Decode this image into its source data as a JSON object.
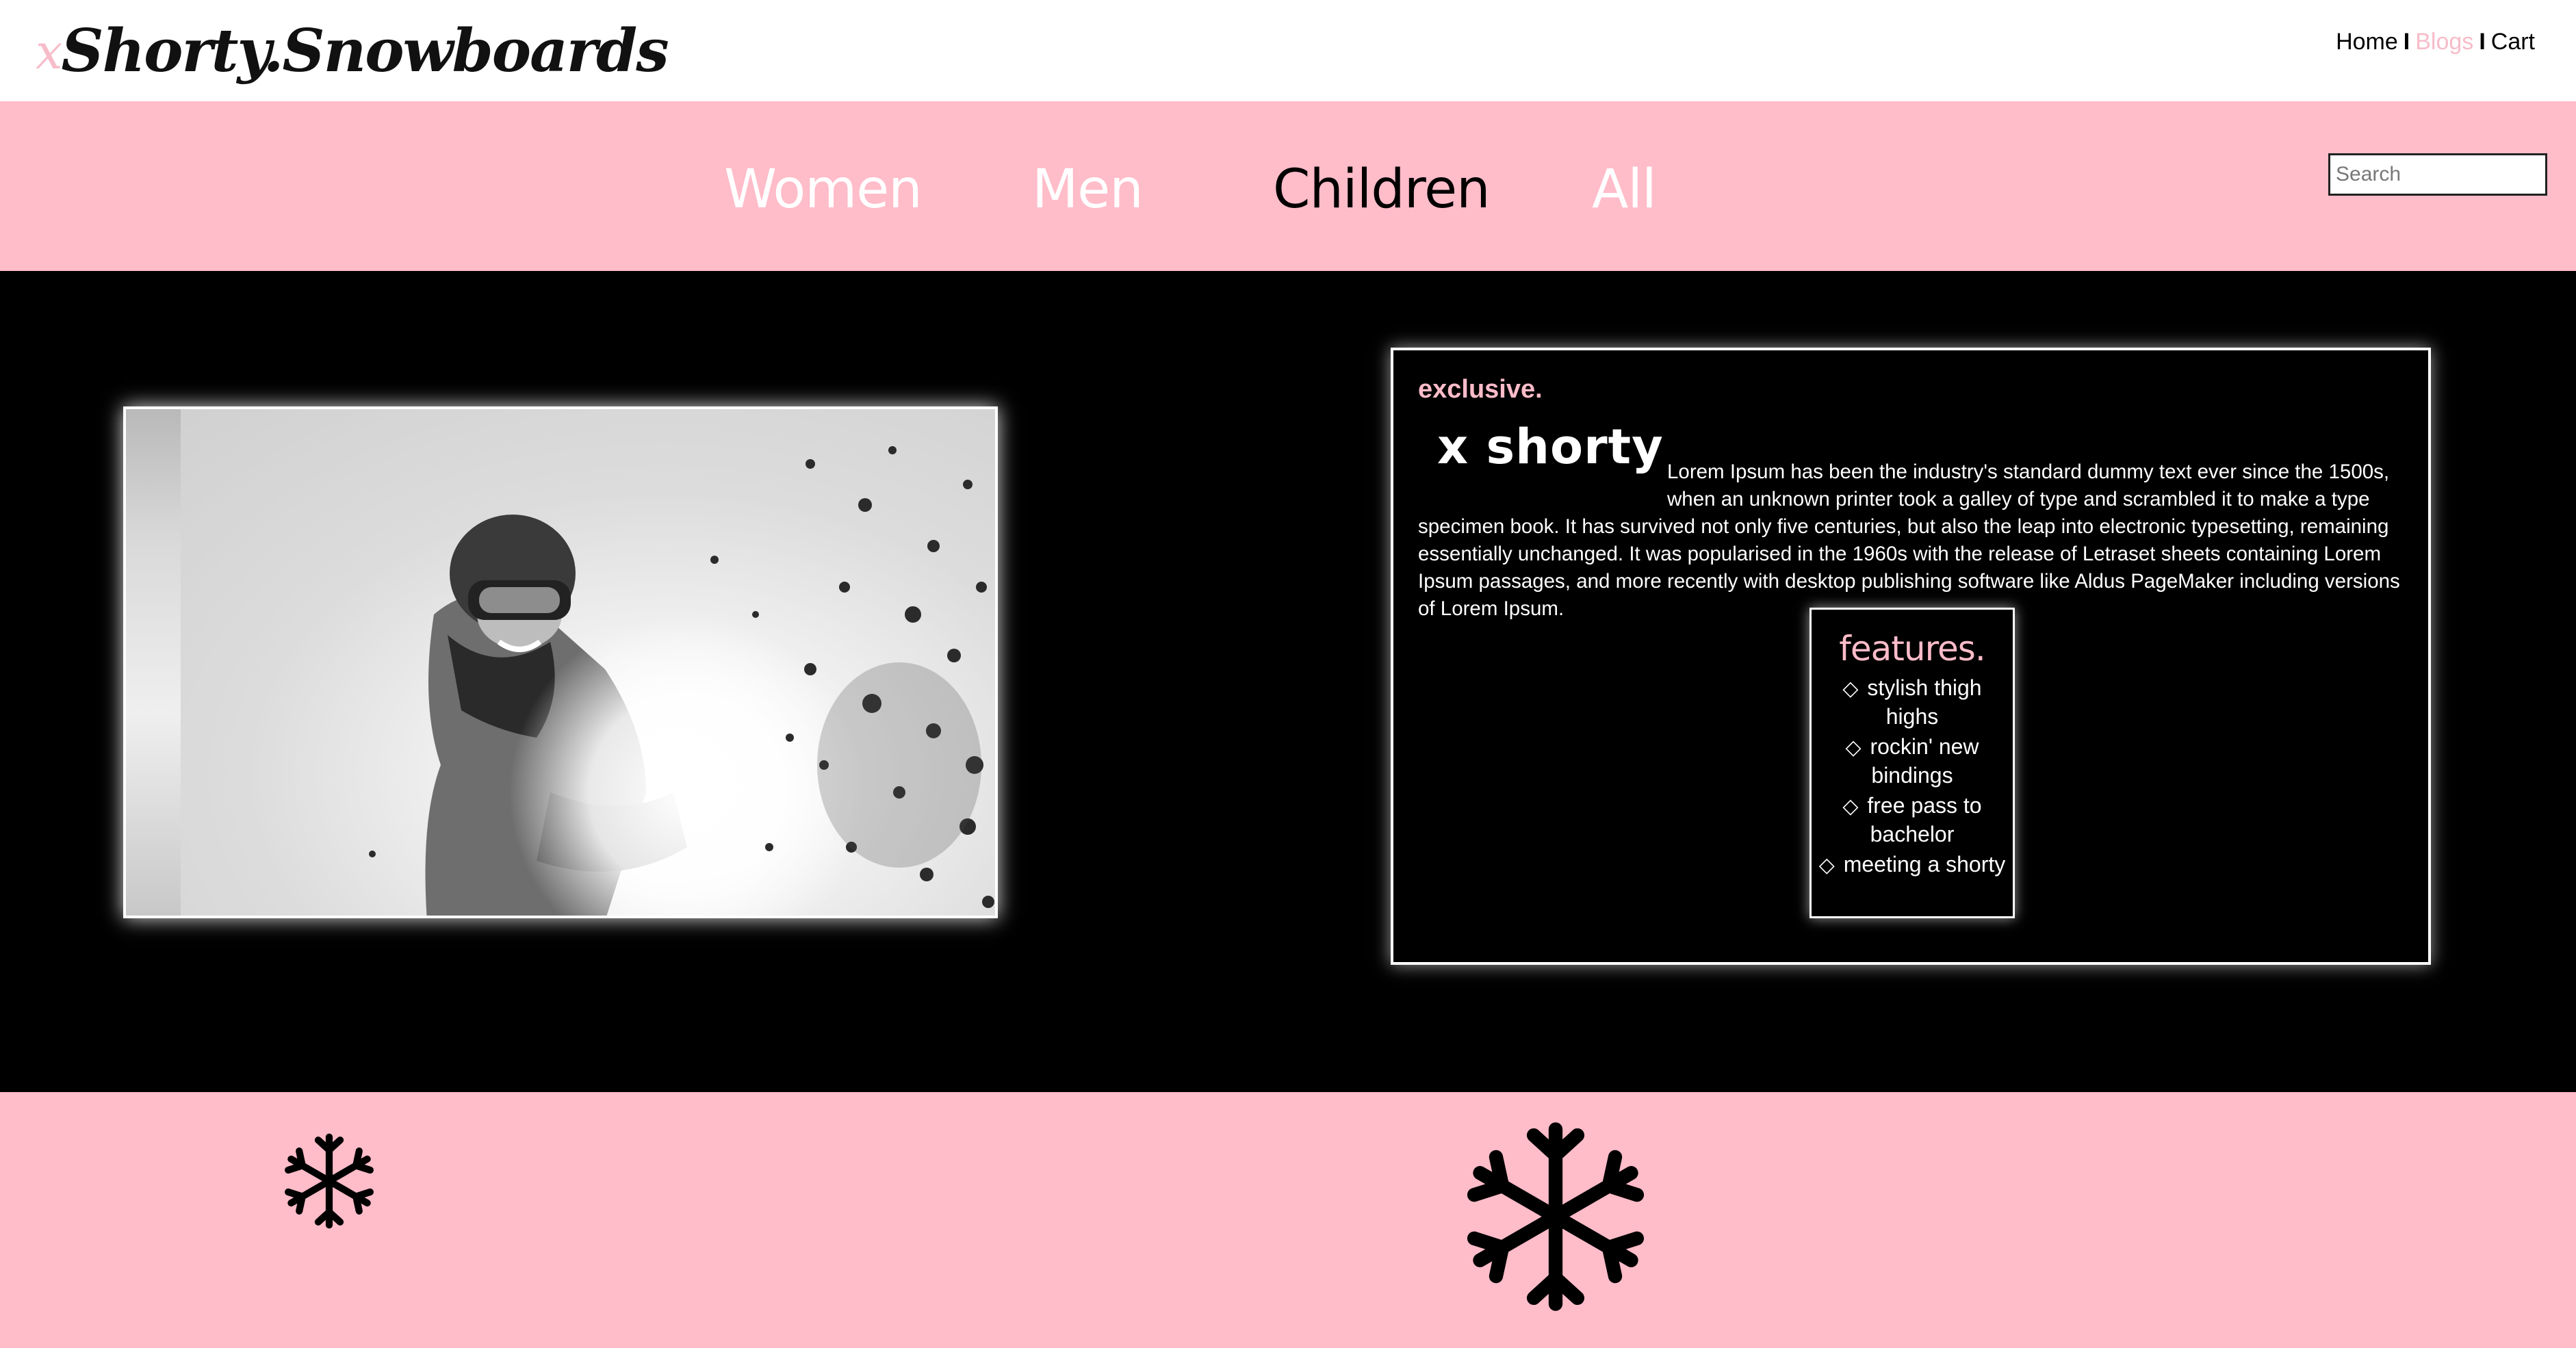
{
  "header": {
    "logo_prefix": "x",
    "logo_text": "Shorty.Snowboards",
    "links": [
      {
        "label": "Home"
      },
      {
        "label": "Blogs"
      },
      {
        "label": "Cart"
      }
    ],
    "separator": "I",
    "active_link": "Blogs"
  },
  "nav": {
    "items": [
      {
        "label": "Women"
      },
      {
        "label": "Men"
      },
      {
        "label": "Children"
      },
      {
        "label": "All"
      }
    ],
    "active_item": "Children",
    "search_placeholder": "Search"
  },
  "hero": {
    "image_icon": "snowboarder-photo",
    "tag": "exclusive.",
    "product_name": "x shorty",
    "description": "Lorem Ipsum has been the industry's standard dummy text ever since the 1500s, when an unknown printer took a galley of type and scrambled it to make a type specimen book. It has survived not only five centuries, but also the leap into electronic typesetting, remaining essentially unchanged. It was popularised in the 1960s with the release of Letraset sheets containing Lorem Ipsum passages, and more recently with desktop publishing software like Aldus PageMaker including versions of Lorem Ipsum.",
    "features": {
      "title": "features.",
      "bullet": "◇",
      "items": [
        "stylish thigh highs",
        "rockin' new bindings",
        "free pass to bachelor",
        "meeting a shorty"
      ]
    }
  },
  "footer": {
    "icons": [
      "snowflake-icon",
      "snowflake-icon"
    ]
  },
  "colors": {
    "brand_pink": "#ffbcc9",
    "background_dark": "#000000",
    "text_light": "#ffffff"
  }
}
